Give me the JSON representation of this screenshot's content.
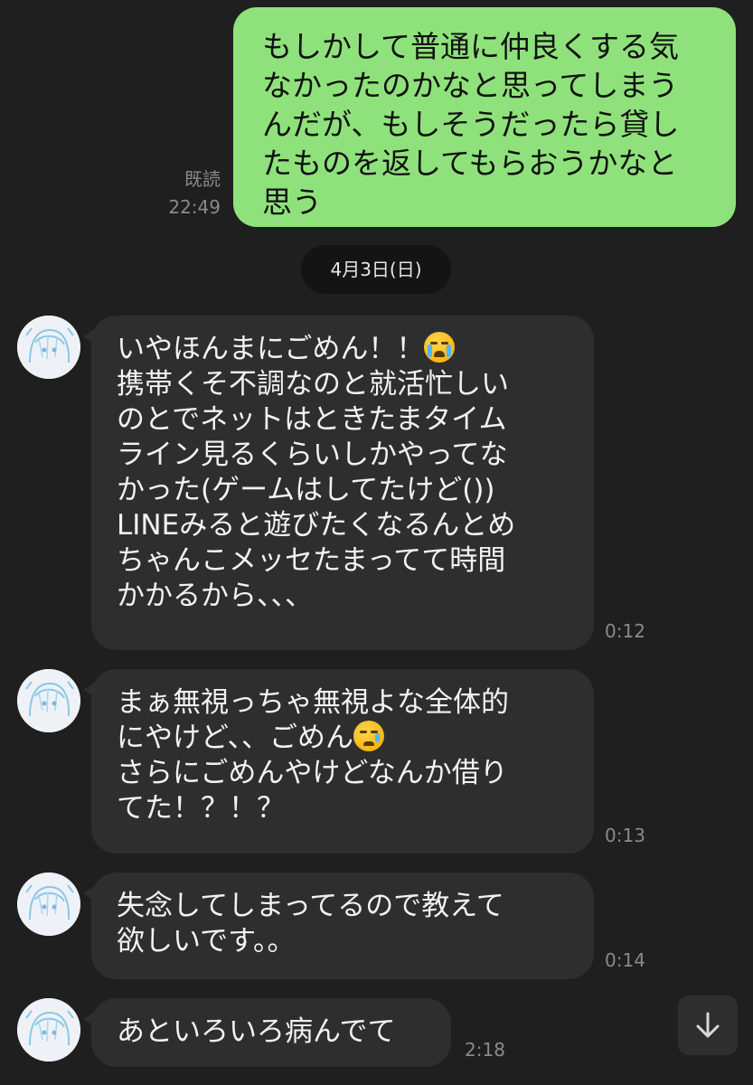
{
  "sent": {
    "text": "もしかして普通に仲良くする気\nなかったのかなと思ってしまう\nんだが、もしそうだったら貸し\nたものを返してもらおうかなと\n思う",
    "read_label": "既読",
    "time": "22:49"
  },
  "date_separator": "4月3日(日)",
  "messages": [
    {
      "text_before_emoji": "いやほんまにごめん！！",
      "emoji": "loudly-crying-face",
      "text_after": "\n携帯くそ不調なのと就活忙しい\nのとでネットはときたまタイム\nライン見るくらいしかやってな\nかった(ゲームはしてたけど())\nLINEみると遊びたくなるんとめ\nちゃんこメッセたまってて時間\nかかるから、、、",
      "time": "0:12"
    },
    {
      "text_before_emoji": "まぁ無視っちゃ無視よな全体的\nにやけど、、ごめん",
      "emoji": "crying-face",
      "text_after": "\nさらにごめんやけどなんか借り\nてた！？！？",
      "time": "0:13"
    },
    {
      "text": "失念してしまってるので教えて\n欲しいです。。",
      "time": "0:14"
    },
    {
      "text": "あといろいろ病んでて",
      "time": "2:18"
    }
  ],
  "colors": {
    "background": "#1f1f1f",
    "sent_bubble": "#8fe27b",
    "received_bubble": "#2e2e2e",
    "meta_text": "#8a8a8a"
  },
  "icons": {
    "scroll_down": "arrow-down-icon",
    "avatar": "avatar"
  }
}
